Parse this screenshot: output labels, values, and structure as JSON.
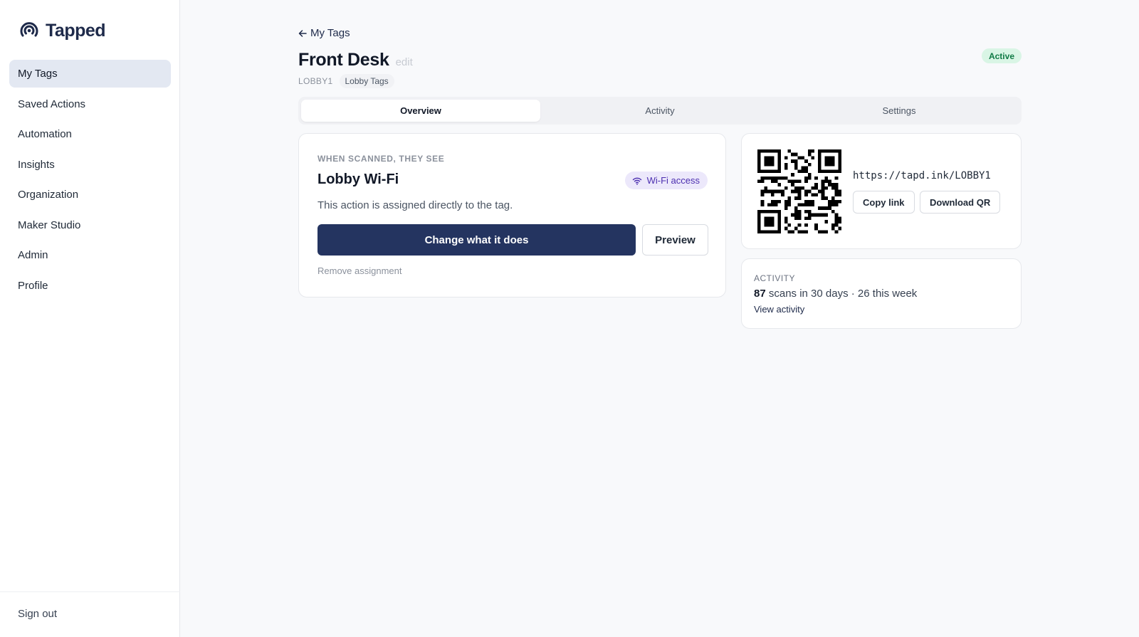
{
  "brand": {
    "name": "Tapped",
    "icon": "tap-signal-logo-icon"
  },
  "sidebar": {
    "items": [
      {
        "label": "My Tags",
        "active": true
      },
      {
        "label": "Saved Actions"
      },
      {
        "label": "Automation"
      },
      {
        "label": "Insights"
      },
      {
        "label": "Organization"
      },
      {
        "label": "Maker Studio"
      },
      {
        "label": "Admin"
      },
      {
        "label": "Profile"
      }
    ],
    "sign_out": "Sign out"
  },
  "header": {
    "back_label": "My Tags",
    "title": "Front Desk",
    "edit_label": "edit",
    "status": "Active",
    "tag_code": "LOBBY1",
    "group": "Lobby Tags"
  },
  "tabs": [
    {
      "label": "Overview",
      "active": true
    },
    {
      "label": "Activity"
    },
    {
      "label": "Settings"
    }
  ],
  "action": {
    "eyebrow": "WHEN SCANNED, THEY SEE",
    "name": "Lobby Wi-Fi",
    "type": "Wi-Fi access",
    "description": "This action is assigned directly to the tag.",
    "primary_label": "Change what it does",
    "preview_label": "Preview",
    "remove_label": "Remove assignment"
  },
  "qr": {
    "url": "https://tapd.ink/LOBBY1",
    "copy_label": "Copy link",
    "download_label": "Download QR"
  },
  "activity": {
    "eyebrow": "ACTIVITY",
    "scans": "87",
    "summary": "scans in 30 days · 26 this week",
    "view_label": "View activity"
  },
  "colors": {
    "accent": "#243460",
    "active_nav": "#e3e8f2",
    "status_bg": "#d9f5e5",
    "status_text": "#107a45",
    "badge_bg": "#ece8fb",
    "badge_text": "#4c2fb0"
  }
}
